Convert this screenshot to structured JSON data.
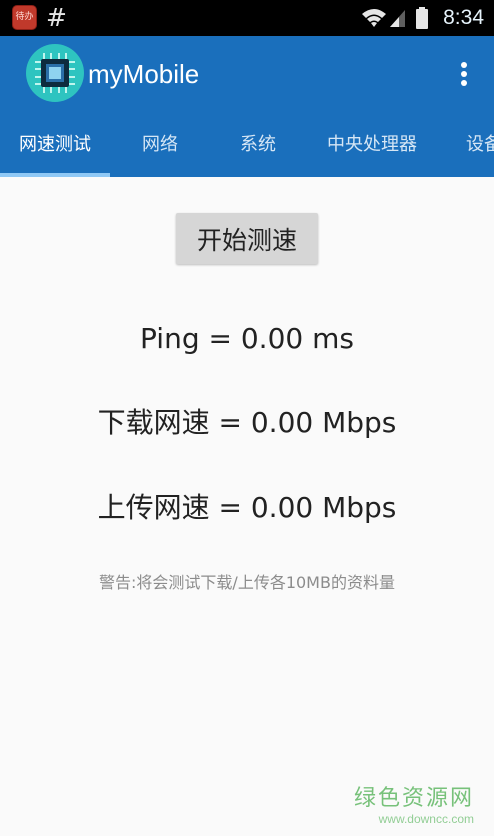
{
  "status_bar": {
    "app_icon_text": "待办",
    "hash_symbol": "#",
    "time": "8:34",
    "icons": [
      "wifi-icon",
      "signal-icon",
      "battery-icon"
    ]
  },
  "app_bar": {
    "title": "myMobile",
    "logo_icon": "chip-icon",
    "menu_icon": "overflow-menu-icon",
    "color": "#1a6fbc"
  },
  "tabs": [
    {
      "label": "网速测试",
      "active": true
    },
    {
      "label": "网络",
      "active": false
    },
    {
      "label": "系统",
      "active": false
    },
    {
      "label": "中央处理器",
      "active": false
    },
    {
      "label": "设备",
      "active": false
    }
  ],
  "speed_test": {
    "start_button": "开始测速",
    "ping": "Ping = 0.00 ms",
    "download": "下载网速 = 0.00 Mbps",
    "upload": "上传网速 = 0.00 Mbps",
    "warning": "警告:将会测试下载/上传各10MB的资料量"
  },
  "watermark": {
    "title": "绿色资源网",
    "url": "www.downcc.com"
  }
}
